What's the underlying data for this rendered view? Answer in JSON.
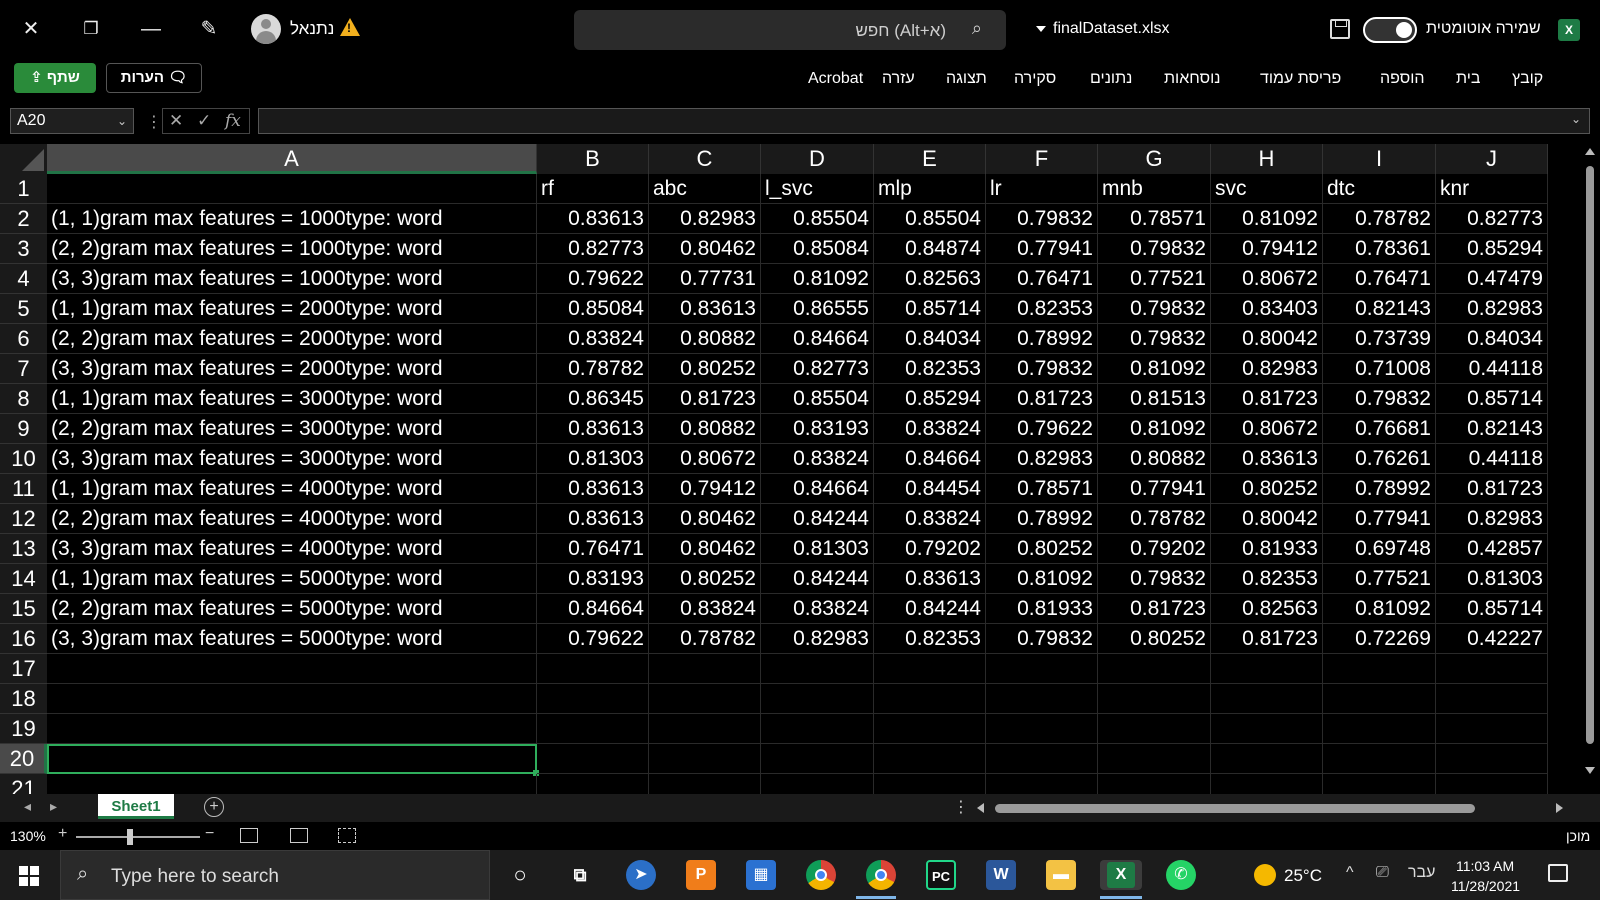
{
  "titlebar": {
    "user_name": "נתנאל",
    "search_placeholder": "חפש (Alt+א)",
    "file_name": "finalDataset.xlsx",
    "autosave_label": "שמירה אוטומטית",
    "autosave_on": true,
    "app_badge": "X"
  },
  "ribbon": {
    "share_label": "שתף",
    "comments_label": "הערות",
    "tabs": [
      "קובץ",
      "בית",
      "הוספה",
      "פריסת עמוד",
      "נוסחאות",
      "נתונים",
      "סקירה",
      "תצוגה",
      "עזרה",
      "Acrobat"
    ]
  },
  "formula_bar": {
    "name_box": "A20",
    "fx": "fx",
    "content": ""
  },
  "grid": {
    "columns": [
      "A",
      "B",
      "C",
      "D",
      "E",
      "F",
      "G",
      "H",
      "I",
      "J"
    ],
    "selected_column": "A",
    "selected_row": "20",
    "active_cell": "A20",
    "header_row": [
      "",
      "rf",
      "abc",
      "l_svc",
      "mlp",
      "lr",
      "mnb",
      "svc",
      "dtc",
      "knr"
    ],
    "rows": [
      [
        "(1, 1)gram max features = 1000type: word",
        "0.83613",
        "0.82983",
        "0.85504",
        "0.85504",
        "0.79832",
        "0.78571",
        "0.81092",
        "0.78782",
        "0.82773"
      ],
      [
        "(2, 2)gram max features = 1000type: word",
        "0.82773",
        "0.80462",
        "0.85084",
        "0.84874",
        "0.77941",
        "0.79832",
        "0.79412",
        "0.78361",
        "0.85294"
      ],
      [
        "(3, 3)gram max features = 1000type: word",
        "0.79622",
        "0.77731",
        "0.81092",
        "0.82563",
        "0.76471",
        "0.77521",
        "0.80672",
        "0.76471",
        "0.47479"
      ],
      [
        "(1, 1)gram max features = 2000type: word",
        "0.85084",
        "0.83613",
        "0.86555",
        "0.85714",
        "0.82353",
        "0.79832",
        "0.83403",
        "0.82143",
        "0.82983"
      ],
      [
        "(2, 2)gram max features = 2000type: word",
        "0.83824",
        "0.80882",
        "0.84664",
        "0.84034",
        "0.78992",
        "0.79832",
        "0.80042",
        "0.73739",
        "0.84034"
      ],
      [
        "(3, 3)gram max features = 2000type: word",
        "0.78782",
        "0.80252",
        "0.82773",
        "0.82353",
        "0.79832",
        "0.81092",
        "0.82983",
        "0.71008",
        "0.44118"
      ],
      [
        "(1, 1)gram max features = 3000type: word",
        "0.86345",
        "0.81723",
        "0.85504",
        "0.85294",
        "0.81723",
        "0.81513",
        "0.81723",
        "0.79832",
        "0.85714"
      ],
      [
        "(2, 2)gram max features = 3000type: word",
        "0.83613",
        "0.80882",
        "0.83193",
        "0.83824",
        "0.79622",
        "0.81092",
        "0.80672",
        "0.76681",
        "0.82143"
      ],
      [
        "(3, 3)gram max features = 3000type: word",
        "0.81303",
        "0.80672",
        "0.83824",
        "0.84664",
        "0.82983",
        "0.80882",
        "0.83613",
        "0.76261",
        "0.44118"
      ],
      [
        "(1, 1)gram max features = 4000type: word",
        "0.83613",
        "0.79412",
        "0.84664",
        "0.84454",
        "0.78571",
        "0.77941",
        "0.80252",
        "0.78992",
        "0.81723"
      ],
      [
        "(2, 2)gram max features = 4000type: word",
        "0.83613",
        "0.80462",
        "0.84244",
        "0.83824",
        "0.78992",
        "0.78782",
        "0.80042",
        "0.77941",
        "0.82983"
      ],
      [
        "(3, 3)gram max features = 4000type: word",
        "0.76471",
        "0.80462",
        "0.81303",
        "0.79202",
        "0.80252",
        "0.79202",
        "0.81933",
        "0.69748",
        "0.42857"
      ],
      [
        "(1, 1)gram max features = 5000type: word",
        "0.83193",
        "0.80252",
        "0.84244",
        "0.83613",
        "0.81092",
        "0.79832",
        "0.82353",
        "0.77521",
        "0.81303"
      ],
      [
        "(2, 2)gram max features = 5000type: word",
        "0.84664",
        "0.83824",
        "0.83824",
        "0.84244",
        "0.81933",
        "0.81723",
        "0.82563",
        "0.81092",
        "0.85714"
      ],
      [
        "(3, 3)gram max features = 5000type: word",
        "0.79622",
        "0.78782",
        "0.82983",
        "0.82353",
        "0.79832",
        "0.80252",
        "0.81723",
        "0.72269",
        "0.42227"
      ]
    ],
    "row_numbers": [
      "1",
      "2",
      "3",
      "4",
      "5",
      "6",
      "7",
      "8",
      "9",
      "10",
      "11",
      "12",
      "13",
      "14",
      "15",
      "16",
      "17",
      "18",
      "19",
      "20",
      "21"
    ]
  },
  "sheets": {
    "tabs": [
      "Sheet1"
    ],
    "active": "Sheet1"
  },
  "status": {
    "zoom": "130%",
    "ready": "מוכן"
  },
  "taskbar": {
    "search_placeholder": "Type here to search",
    "temperature": "25°C",
    "language": "עבר",
    "time": "11:03 AM",
    "date": "11/28/2021",
    "apps": [
      "cortana-icon",
      "task-view-icon",
      "browser-icon",
      "pdf-app-icon",
      "calendar-icon",
      "chrome-icon",
      "chrome-profile-icon",
      "pycharm-icon",
      "word-icon",
      "file-explorer-icon",
      "excel-icon",
      "whatsapp-icon"
    ]
  },
  "colors": {
    "accent_green": "#217346",
    "share_green": "#2a8b3a",
    "warning": "#f2b01e"
  }
}
